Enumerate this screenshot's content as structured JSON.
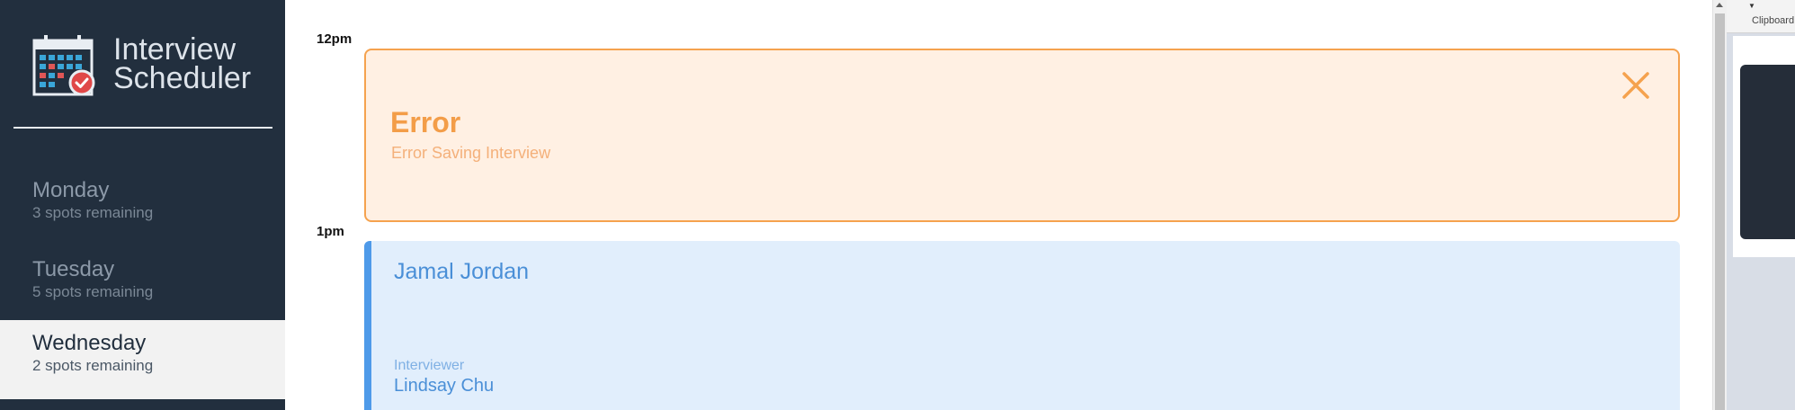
{
  "app": {
    "title_line1": "Interview",
    "title_line2": "Scheduler"
  },
  "sidebar": {
    "days": [
      {
        "name": "Monday",
        "spots": "3 spots remaining",
        "selected": false
      },
      {
        "name": "Tuesday",
        "spots": "5 spots remaining",
        "selected": false
      },
      {
        "name": "Wednesday",
        "spots": "2 spots remaining",
        "selected": true
      }
    ]
  },
  "schedule": {
    "slots": [
      {
        "time": "12pm",
        "error": {
          "title": "Error",
          "message": "Error Saving Interview",
          "close_icon": "close-icon"
        }
      },
      {
        "time": "1pm",
        "appointment": {
          "student": "Jamal Jordan",
          "interviewer_label": "Interviewer",
          "interviewer": "Lindsay Chu"
        }
      }
    ]
  },
  "side_panel": {
    "label": "Clipboard"
  },
  "colors": {
    "sidebar_bg": "#222f3e",
    "error_accent": "#f5a24e",
    "error_bg": "#fff0e3",
    "appointment_accent": "#4e9ae9",
    "appointment_bg": "#e1eefc"
  }
}
